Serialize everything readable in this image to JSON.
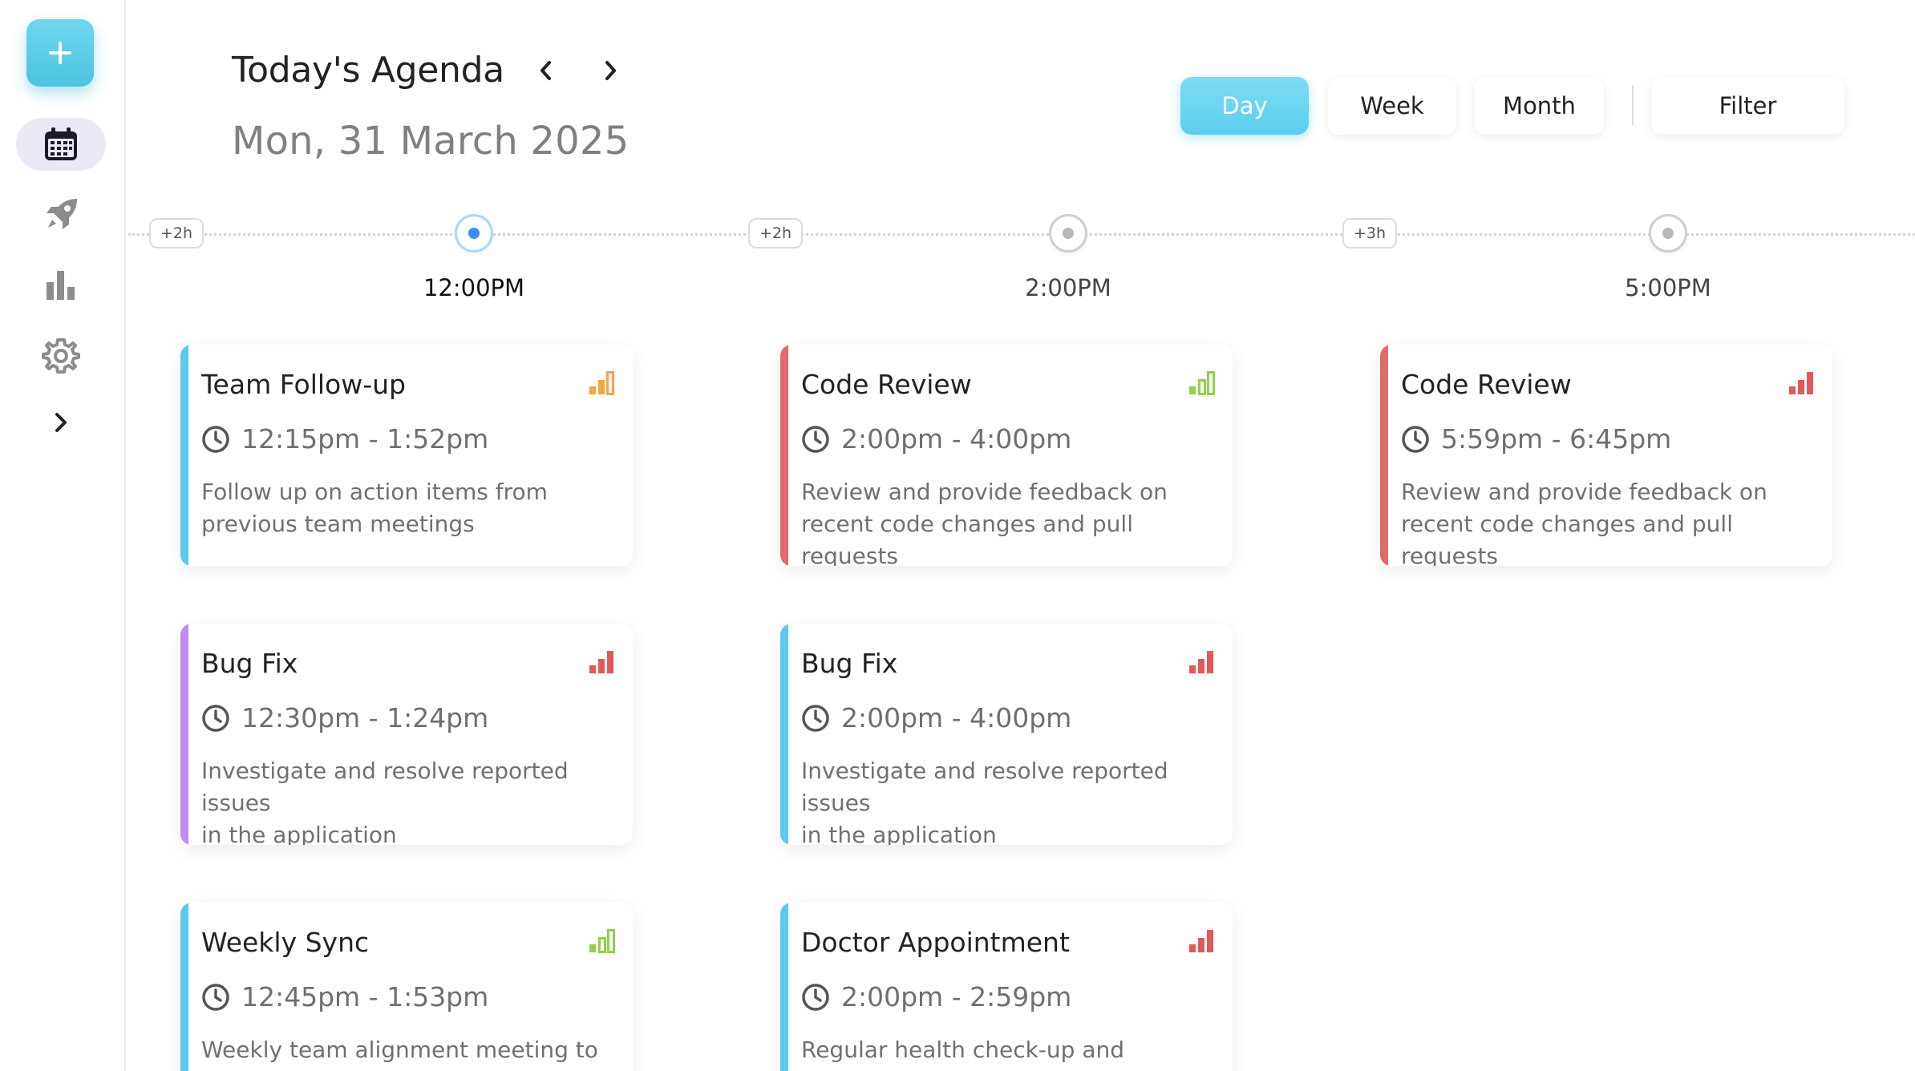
{
  "header": {
    "title": "Today's Agenda",
    "date": "Mon, 31 March 2025"
  },
  "views": {
    "day": "Day",
    "week": "Week",
    "month": "Month",
    "filter": "Filter",
    "active": "Day"
  },
  "sidebar": {
    "items": [
      {
        "icon": "calendar-icon",
        "active": true
      },
      {
        "icon": "rocket-icon",
        "active": false
      },
      {
        "icon": "bar-chart-icon",
        "active": false
      },
      {
        "icon": "gear-icon",
        "active": false
      },
      {
        "icon": "chevron-right-icon",
        "active": false
      }
    ]
  },
  "timeline": {
    "gaps": [
      "+2h",
      "+2h",
      "+3h"
    ],
    "slots": [
      {
        "label": "12:00PM",
        "active": true
      },
      {
        "label": "2:00PM",
        "active": false
      },
      {
        "label": "5:00PM",
        "active": false
      }
    ]
  },
  "colors": {
    "accent": "#5ccdef",
    "blue_bar": "#5bc8ee",
    "red_bar": "#e06a6a",
    "purple_bar": "#c08af0",
    "prio_orange": "#f4a63c",
    "prio_green": "#8ed14a",
    "prio_red": "#e05a5a"
  },
  "columns": [
    {
      "events": [
        {
          "title": "Team Follow-up",
          "time": "12:15pm - 1:52pm",
          "desc_line1": "Follow up on action items from",
          "desc_line2": "previous team meetings",
          "bar": "blue",
          "priority": "medium"
        },
        {
          "title": "Bug Fix",
          "time": "12:30pm - 1:24pm",
          "desc_line1": "Investigate and resolve reported issues",
          "desc_line2": "in the application",
          "bar": "purple",
          "priority": "high"
        },
        {
          "title": "Weekly Sync",
          "time": "12:45pm - 1:53pm",
          "desc_line1": "Weekly team alignment meeting to",
          "desc_line2": "",
          "bar": "blue",
          "priority": "low"
        }
      ]
    },
    {
      "events": [
        {
          "title": "Code Review",
          "time": "2:00pm - 4:00pm",
          "desc_line1": "Review and provide feedback on",
          "desc_line2": "recent code changes and pull requests",
          "bar": "red",
          "priority": "low"
        },
        {
          "title": "Bug Fix",
          "time": "2:00pm - 4:00pm",
          "desc_line1": "Investigate and resolve reported issues",
          "desc_line2": "in the application",
          "bar": "blue",
          "priority": "high"
        },
        {
          "title": "Doctor Appointment",
          "time": "2:00pm - 2:59pm",
          "desc_line1": "Regular health check-up and",
          "desc_line2": "",
          "bar": "blue",
          "priority": "high"
        }
      ]
    },
    {
      "events": [
        {
          "title": "Code Review",
          "time": "5:59pm - 6:45pm",
          "desc_line1": "Review and provide feedback on",
          "desc_line2": "recent code changes and pull requests",
          "bar": "red",
          "priority": "high"
        }
      ]
    }
  ]
}
